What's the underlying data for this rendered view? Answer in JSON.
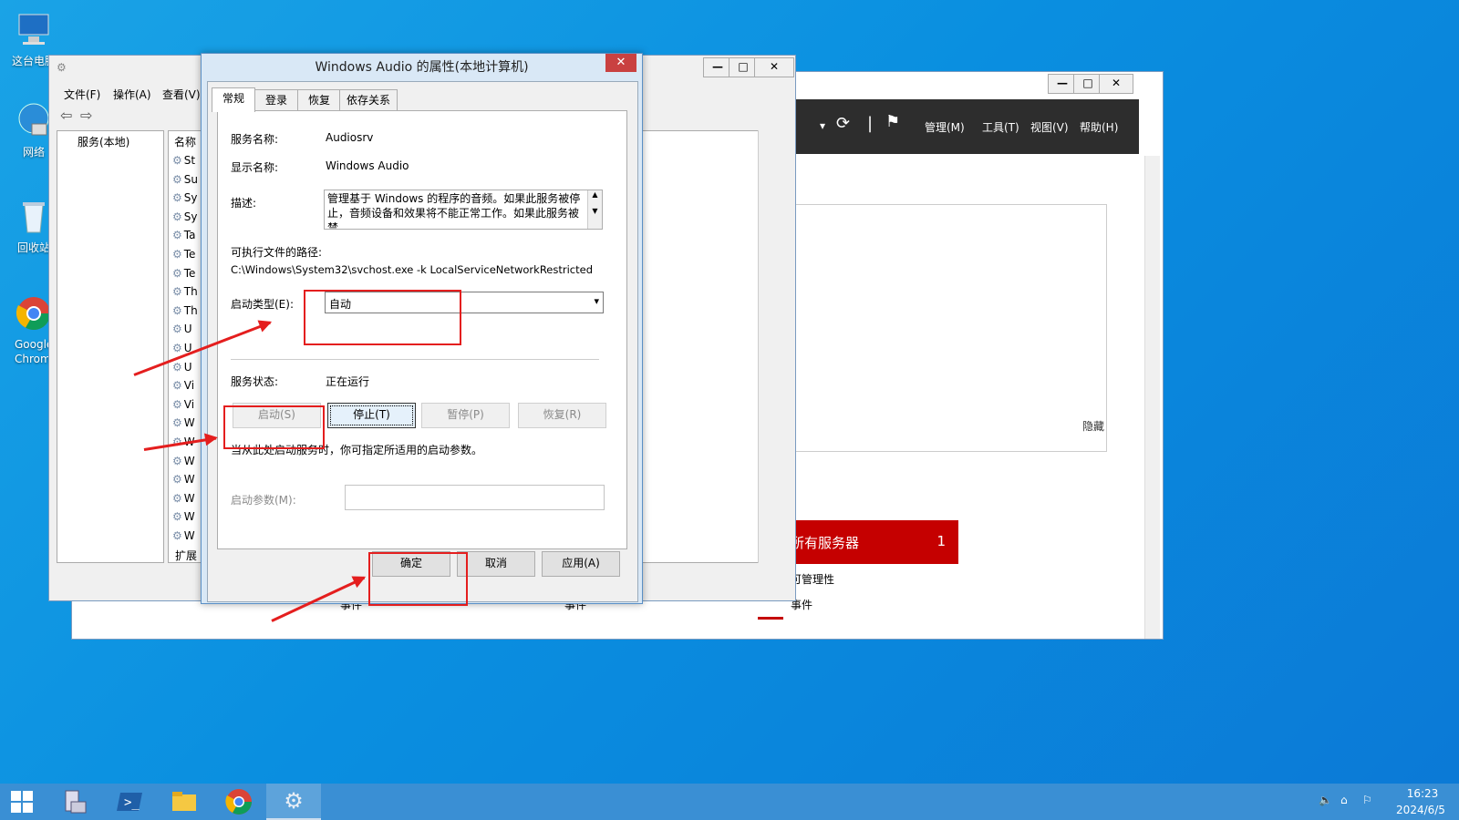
{
  "desktop": {
    "icons": [
      {
        "label": "这台电脑"
      },
      {
        "label": "网络"
      },
      {
        "label": "回收站"
      },
      {
        "label": "Google Chrome"
      }
    ]
  },
  "server_manager": {
    "menu": [
      "管理(M)",
      "工具(T)",
      "视图(V)",
      "帮助(H)"
    ],
    "hide_label": "隐藏",
    "all_servers": {
      "title": "所有服务器",
      "count": "1"
    },
    "manageability": "可管理性",
    "events": [
      "事件",
      "事件",
      "事件"
    ]
  },
  "services_window": {
    "menu": [
      "文件(F)",
      "操作(A)",
      "查看(V)"
    ],
    "tree_root": "服务(本地)",
    "col_name": "名称",
    "row_initials": [
      "St",
      "Su",
      "Sy",
      "Sy",
      "Ta",
      "Te",
      "Te",
      "Th",
      "Th",
      "U",
      "U",
      "U",
      "Vi",
      "Vi",
      "W",
      "W",
      "W",
      "W",
      "W",
      "W",
      "W"
    ],
    "tab_extended": "扩展"
  },
  "dialog": {
    "title": "Windows Audio 的属性(本地计算机)",
    "tabs": [
      "常规",
      "登录",
      "恢复",
      "依存关系"
    ],
    "service_name_label": "服务名称:",
    "service_name": "Audiosrv",
    "display_name_label": "显示名称:",
    "display_name": "Windows Audio",
    "description_label": "描述:",
    "description": "管理基于 Windows 的程序的音频。如果此服务被停止，音频设备和效果将不能正常工作。如果此服务被禁",
    "path_label": "可执行文件的路径:",
    "path": "C:\\Windows\\System32\\svchost.exe -k LocalServiceNetworkRestricted",
    "startup_type_label": "启动类型(E):",
    "startup_type": "自动",
    "status_label": "服务状态:",
    "status": "正在运行",
    "btn_start": "启动(S)",
    "btn_stop": "停止(T)",
    "btn_pause": "暂停(P)",
    "btn_resume": "恢复(R)",
    "hint": "当从此处启动服务时，你可指定所适用的启动参数。",
    "params_label": "启动参数(M):",
    "params_value": "",
    "btn_ok": "确定",
    "btn_cancel": "取消",
    "btn_apply": "应用(A)"
  },
  "taskbar": {
    "time": "16:23",
    "date": "2024/6/5"
  },
  "colors": {
    "annotation": "#e41e1e",
    "server_card": "#c50000"
  }
}
